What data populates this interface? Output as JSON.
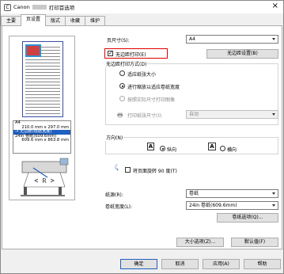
{
  "window": {
    "logo": "C",
    "title_prefix": "Canon",
    "title_suffix": "打印首选项",
    "close": "×"
  },
  "tabs": [
    "主要",
    "页设置",
    "版式",
    "收藏",
    "维护"
  ],
  "info": {
    "paper": "A4",
    "paper_size": "210.0 mm x 297.0 mm",
    "mode": "无边距(根据宽度)",
    "roll": "24in 卷纸(609.6mm)",
    "roll_size": "609.6 mm x 863.8 mm"
  },
  "page_size": {
    "label": "页尺寸(S):",
    "value": "A4"
  },
  "borderless": {
    "label": "无边距打印(E)",
    "checked": true,
    "settings_button": "无边距设置(B)"
  },
  "method": {
    "title": "无边距打印方式(D)",
    "options": [
      {
        "label": "适应纸张大小",
        "selected": false,
        "enabled": true
      },
      {
        "label": "进行缩放以适应卷纸宽度",
        "selected": true,
        "enabled": true
      },
      {
        "label": "按照实际尺寸打印图像",
        "selected": false,
        "enabled": false
      }
    ],
    "print_size_label": "打印纸张尺寸(I):",
    "print_size_value": "自动"
  },
  "orientation": {
    "title": "方向(N)",
    "portrait": "纵向",
    "landscape": "横向",
    "selected": "portrait",
    "icon_letter": "A"
  },
  "rotate": {
    "label": "将页面旋转 90 度(T)",
    "checked": false
  },
  "paper_source": {
    "label": "纸源(R):",
    "value": "卷纸"
  },
  "roll_width": {
    "label": "卷纸宽度(L):",
    "value": "24in 卷纸(609.6mm)"
  },
  "roll_options_button": "卷纸选项(Q)...",
  "size_options_button": "大小选项(Z)...",
  "defaults_button": "默认值(F)",
  "footer": {
    "ok": "确定",
    "cancel": "取消",
    "apply": "应用(A)",
    "help": "帮助"
  }
}
